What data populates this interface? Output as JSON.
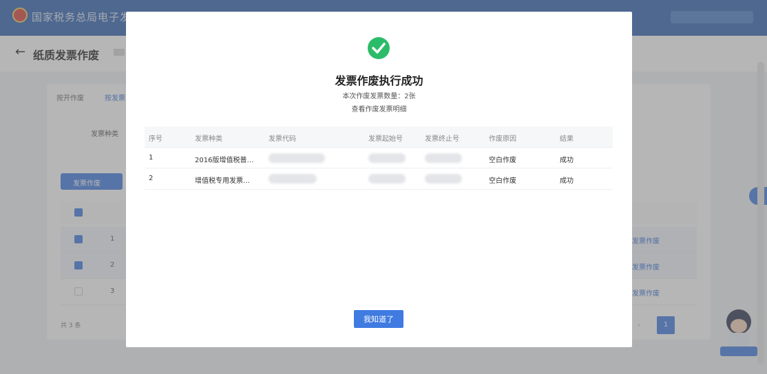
{
  "topbar": {
    "title": "国家税务总局电子发"
  },
  "header": {
    "back_icon": "back-arrow-icon",
    "title": "纸质发票作废"
  },
  "background": {
    "tabs": [
      "按开作废",
      "按发票"
    ],
    "filter_label": "发票种类",
    "action_button": "发票作废",
    "rows": [
      "1",
      "2",
      "3"
    ],
    "row_action": "发票作废",
    "total_label": "共 3 条",
    "current_page": "1"
  },
  "modal": {
    "status_icon": "check-circle-icon",
    "title": "发票作废执行成功",
    "summary": "本次作废发票数量：2张",
    "detail_link": "查看作废发票明细",
    "columns": [
      "序号",
      "发票种类",
      "发票代码",
      "发票起始号",
      "发票终止号",
      "作废原因",
      "结果"
    ],
    "rows": [
      {
        "index": "1",
        "type": "2016版增值税普…",
        "reason": "空白作废",
        "result": "成功"
      },
      {
        "index": "2",
        "type": "增值税专用发票…",
        "reason": "空白作废",
        "result": "成功"
      }
    ],
    "ack_button": "我知道了"
  },
  "colors": {
    "accent": "#3f7be0",
    "success": "#2bbc6a",
    "topbar": "#2f63b3"
  }
}
